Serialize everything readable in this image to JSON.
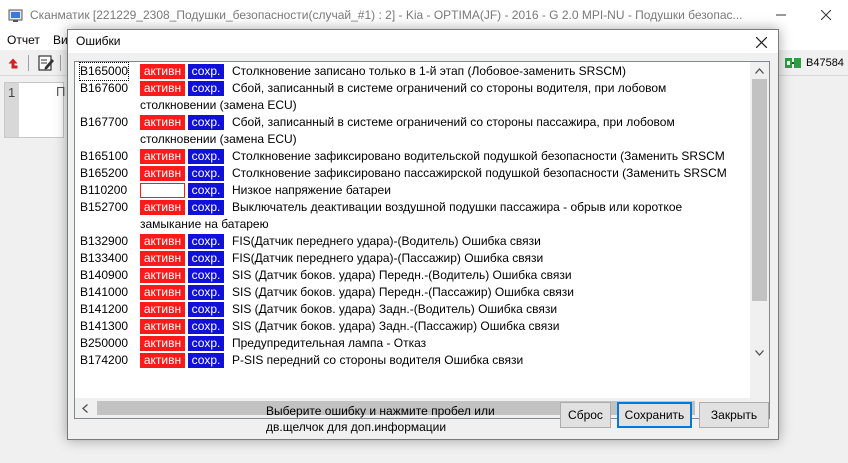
{
  "window": {
    "title": "Сканматик [221229_2308_Подушки_безопасности(случай_#1) : 2] - Kia - OPTIMA(JF) - 2016 - G 2.0 MPI-NU - Подушки безопас..."
  },
  "menu": {
    "items": [
      "Отчет",
      "Ви"
    ]
  },
  "toolbar": {
    "right_code": "B47584"
  },
  "editor": {
    "line_number": "1",
    "text": "П"
  },
  "dialog": {
    "title": "Ошибки",
    "rows": [
      {
        "code": "B165000",
        "active": "активн",
        "saved": "сохр.",
        "desc": "Столкновение записано только в 1-й этап (Лобовое-заменить SRSCM)",
        "desc2": ""
      },
      {
        "code": "B167600",
        "active": "активн",
        "saved": "сохр.",
        "desc": "Сбой, записанный в системе ограничений со стороны водителя, при лобовом",
        "desc2": "столкновении (замена ECU)"
      },
      {
        "code": "B167700",
        "active": "активн",
        "saved": "сохр.",
        "desc": "Сбой, записанный в системе ограничений со стороны пассажира, при лобовом",
        "desc2": "столкновении (замена ECU)"
      },
      {
        "code": "B165100",
        "active": "активн",
        "saved": "сохр.",
        "desc": "Столкновение зафиксировано водительской подушкой безопасности (Заменить SRSCM",
        "desc2": ""
      },
      {
        "code": "B165200",
        "active": "активн",
        "saved": "сохр.",
        "desc": "Столкновение зафиксировано пассажирской подушкой безопасности (Заменить SRSCM",
        "desc2": ""
      },
      {
        "code": "B110200",
        "active": "",
        "saved": "сохр.",
        "desc": "Низкое напряжение батареи",
        "desc2": ""
      },
      {
        "code": "B152700",
        "active": "активн",
        "saved": "сохр.",
        "desc": "Выключатель деактивации воздушной подушки пассажира - обрыв или короткое",
        "desc2": "замыкание на батарею"
      },
      {
        "code": "B132900",
        "active": "активн",
        "saved": "сохр.",
        "desc": "FIS(Датчик переднего удара)-(Водитель) Ошибка связи",
        "desc2": ""
      },
      {
        "code": "B133400",
        "active": "активн",
        "saved": "сохр.",
        "desc": "FIS(Датчик переднего удара)-(Пассажир) Ошибка связи",
        "desc2": ""
      },
      {
        "code": "B140900",
        "active": "активн",
        "saved": "сохр.",
        "desc": "SIS (Датчик боков. удара) Передн.-(Водитель) Ошибка связи",
        "desc2": ""
      },
      {
        "code": "B141000",
        "active": "активн",
        "saved": "сохр.",
        "desc": "SIS (Датчик боков. удара) Передн.-(Пассажир) Ошибка связи",
        "desc2": ""
      },
      {
        "code": "B141200",
        "active": "активн",
        "saved": "сохр.",
        "desc": "SIS (Датчик боков. удара) Задн.-(Водитель) Ошибка связи",
        "desc2": ""
      },
      {
        "code": "B141300",
        "active": "активн",
        "saved": "сохр.",
        "desc": "SIS (Датчик боков. удара) Задн.-(Пассажир) Ошибка связи",
        "desc2": ""
      },
      {
        "code": "B250000",
        "active": "активн",
        "saved": "сохр.",
        "desc": "Предупредительная лампа - Отказ",
        "desc2": ""
      },
      {
        "code": "B174200",
        "active": "активн",
        "saved": "сохр.",
        "desc": "P-SIS передний со стороны водителя Ошибка связи",
        "desc2": ""
      }
    ],
    "hint_line1": "Выберите ошибку и нажмите пробел или",
    "hint_line2": "дв.щелчок для доп.информации",
    "reset_label": "Сброс",
    "save_label": "Сохранить",
    "close_label": "Закрыть"
  },
  "colors": {
    "active_badge": "#ff1a1a",
    "saved_badge": "#1010d8",
    "default_button_border": "#0078d7"
  }
}
